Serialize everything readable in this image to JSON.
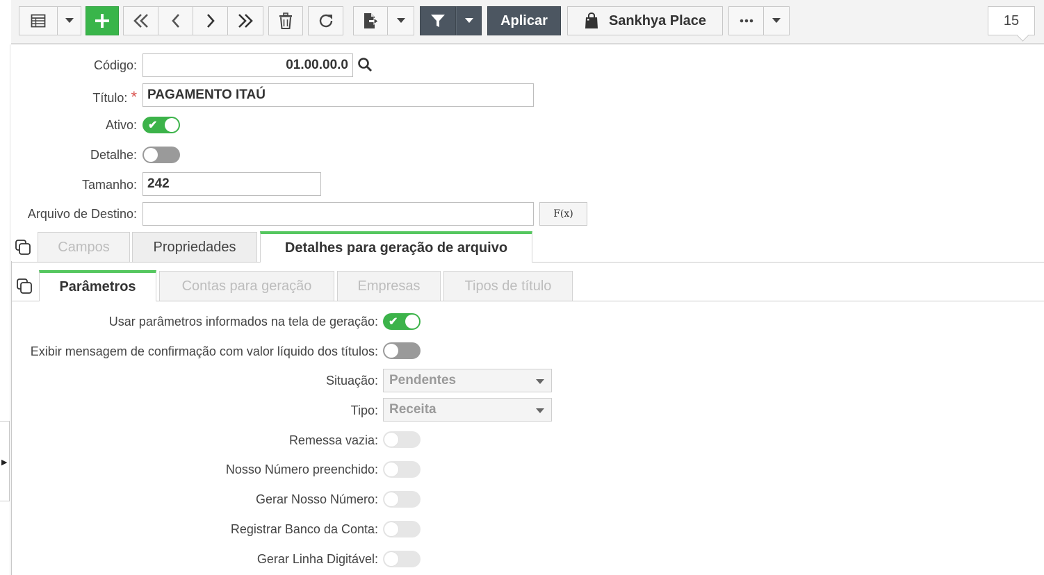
{
  "toolbar": {
    "apply_label": "Aplicar",
    "place_label": "Sankhya Place",
    "page_number": "15"
  },
  "form": {
    "codigo": {
      "label": "Código:",
      "value": "01.00.00.0"
    },
    "titulo": {
      "label": "Título:",
      "required_mark": "*",
      "value": "PAGAMENTO ITAÚ"
    },
    "ativo": {
      "label": "Ativo:",
      "on": true
    },
    "detalhe": {
      "label": "Detalhe:",
      "on": false
    },
    "tamanho": {
      "label": "Tamanho:",
      "value": "242"
    },
    "arquivo_destino": {
      "label": "Arquivo de Destino:",
      "value": ""
    },
    "fx_label": "F(x)"
  },
  "tabs": [
    {
      "label": "Campos",
      "state": "disabled"
    },
    {
      "label": "Propriedades",
      "state": "normal"
    },
    {
      "label": "Detalhes para geração de arquivo",
      "state": "active"
    }
  ],
  "subtabs": [
    {
      "label": "Parâmetros",
      "state": "active"
    },
    {
      "label": "Contas para geração",
      "state": "disabled"
    },
    {
      "label": "Empresas",
      "state": "disabled"
    },
    {
      "label": "Tipos de título",
      "state": "disabled"
    }
  ],
  "params": {
    "usar_parametros": {
      "label": "Usar parâmetros informados na tela de geração:",
      "on": true
    },
    "exibir_mensagem": {
      "label": "Exibir mensagem de confirmação com valor líquido dos títulos:",
      "on": false
    },
    "situacao": {
      "label": "Situação:",
      "value": "Pendentes"
    },
    "tipo": {
      "label": "Tipo:",
      "value": "Receita"
    },
    "remessa_vazia": {
      "label": "Remessa vazia:",
      "on": false
    },
    "nosso_numero_preenchido": {
      "label": "Nosso Número preenchido:",
      "on": false
    },
    "gerar_nosso_numero": {
      "label": "Gerar Nosso Número:",
      "on": false
    },
    "registrar_banco": {
      "label": "Registrar Banco da Conta:",
      "on": false
    },
    "gerar_linha_digitavel": {
      "label": "Gerar Linha Digitável:",
      "on": false
    }
  },
  "colors": {
    "accent_green": "#39b54a",
    "dark_button": "#4c5661",
    "required": "#d9534f"
  }
}
